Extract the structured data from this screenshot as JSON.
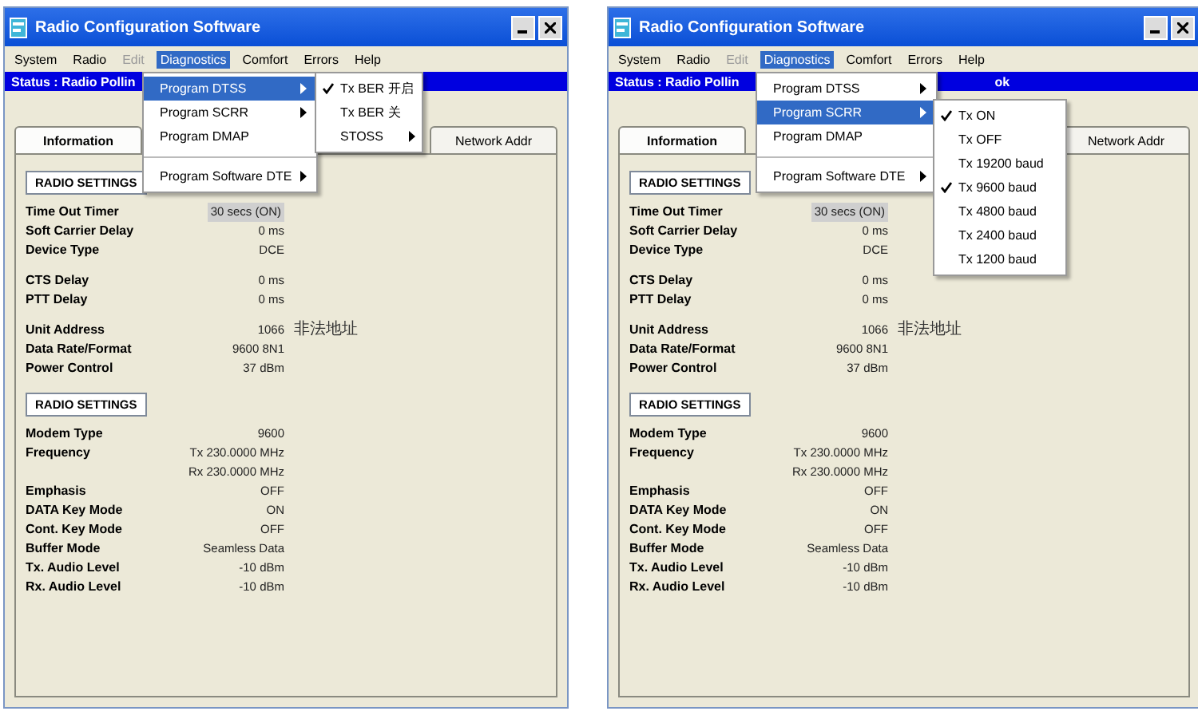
{
  "windows": [
    {
      "title": "Radio Configuration Software",
      "menus": [
        {
          "label": "System",
          "disabled": false,
          "open": false
        },
        {
          "label": "Radio",
          "disabled": false,
          "open": false
        },
        {
          "label": "Edit",
          "disabled": true,
          "open": false
        },
        {
          "label": "Diagnostics",
          "disabled": false,
          "open": true
        },
        {
          "label": "Comfort",
          "disabled": false,
          "open": false
        },
        {
          "label": "Errors",
          "disabled": false,
          "open": false
        },
        {
          "label": "Help",
          "disabled": false,
          "open": false
        }
      ],
      "status": "Status : Radio Pollin",
      "tabs": [
        {
          "label": "Information",
          "selected": true
        },
        {
          "label": "Network Addr",
          "selected": false
        }
      ],
      "sections": [
        {
          "heading": "RADIO SETTINGS",
          "groups": [
            {
              "rows": [
                {
                  "label": "Time Out Timer",
                  "values": [
                    "30 secs (ON)"
                  ],
                  "highlighted": true
                },
                {
                  "label": "Soft Carrier Delay",
                  "values": [
                    "0 ms"
                  ],
                  "highlighted": false
                },
                {
                  "label": "Device Type",
                  "values": [
                    "DCE"
                  ],
                  "highlighted": false
                }
              ]
            },
            {
              "rows": [
                {
                  "label": "CTS Delay",
                  "values": [
                    "0 ms"
                  ],
                  "highlighted": false
                },
                {
                  "label": "PTT Delay",
                  "values": [
                    "0 ms"
                  ],
                  "highlighted": false
                }
              ]
            },
            {
              "rows": [
                {
                  "label": "Unit Address",
                  "values": [
                    "1066"
                  ],
                  "note": "非法地址",
                  "highlighted": false
                },
                {
                  "label": "Data Rate/Format",
                  "values": [
                    "9600 8N1"
                  ],
                  "highlighted": false
                },
                {
                  "label": "Power Control",
                  "values": [
                    "37 dBm"
                  ],
                  "highlighted": false
                }
              ]
            }
          ]
        },
        {
          "heading": "RADIO SETTINGS",
          "groups": [
            {
              "rows": [
                {
                  "label": "Modem Type",
                  "values": [
                    "9600"
                  ],
                  "highlighted": false
                },
                {
                  "label": "Frequency",
                  "values": [
                    "Tx 230.0000 MHz",
                    "Rx 230.0000 MHz"
                  ],
                  "highlighted": false
                },
                {
                  "label": "Emphasis",
                  "values": [
                    "OFF"
                  ],
                  "highlighted": false
                },
                {
                  "label": "DATA Key Mode",
                  "values": [
                    "ON"
                  ],
                  "highlighted": false
                },
                {
                  "label": "Cont. Key Mode",
                  "values": [
                    "OFF"
                  ],
                  "highlighted": false
                },
                {
                  "label": "Buffer Mode",
                  "values": [
                    "Seamless Data"
                  ],
                  "highlighted": false
                },
                {
                  "label": "Tx. Audio Level",
                  "values": [
                    "-10 dBm"
                  ],
                  "highlighted": false
                },
                {
                  "label": "Rx. Audio Level",
                  "values": [
                    "-10 dBm"
                  ],
                  "highlighted": false
                }
              ]
            }
          ]
        }
      ],
      "dropdown": {
        "items": [
          {
            "label": "Program DTSS",
            "submenu": true,
            "selected": true,
            "separator_before": false
          },
          {
            "label": "Program SCRR",
            "submenu": true,
            "selected": false,
            "separator_before": false
          },
          {
            "label": "Program DMAP",
            "submenu": false,
            "selected": false,
            "separator_before": false
          },
          {
            "label": "Program Software DTE",
            "submenu": true,
            "selected": false,
            "separator_before": true
          }
        ],
        "submenu": {
          "items": [
            {
              "label": "Tx BER 开启",
              "checked": true,
              "submenu": false
            },
            {
              "label": "Tx BER 关",
              "checked": false,
              "submenu": false
            },
            {
              "label": "STOSS",
              "checked": false,
              "submenu": true
            }
          ]
        }
      }
    },
    {
      "title": "Radio Configuration Software",
      "menus": [
        {
          "label": "System",
          "disabled": false,
          "open": false
        },
        {
          "label": "Radio",
          "disabled": false,
          "open": false
        },
        {
          "label": "Edit",
          "disabled": true,
          "open": false
        },
        {
          "label": "Diagnostics",
          "disabled": false,
          "open": true
        },
        {
          "label": "Comfort",
          "disabled": false,
          "open": false
        },
        {
          "label": "Errors",
          "disabled": false,
          "open": false
        },
        {
          "label": "Help",
          "disabled": false,
          "open": false
        }
      ],
      "status": "Status : Radio Pollin",
      "status_tail": "ok",
      "tabs": [
        {
          "label": "Information",
          "selected": true
        },
        {
          "label": "Network Addr",
          "selected": false
        }
      ],
      "sections": [
        {
          "heading": "RADIO SETTINGS",
          "groups": [
            {
              "rows": [
                {
                  "label": "Time Out Timer",
                  "values": [
                    "30 secs (ON)"
                  ],
                  "highlighted": true
                },
                {
                  "label": "Soft Carrier Delay",
                  "values": [
                    "0 ms"
                  ],
                  "highlighted": false
                },
                {
                  "label": "Device Type",
                  "values": [
                    "DCE"
                  ],
                  "highlighted": false
                }
              ]
            },
            {
              "rows": [
                {
                  "label": "CTS Delay",
                  "values": [
                    "0 ms"
                  ],
                  "highlighted": false
                },
                {
                  "label": "PTT Delay",
                  "values": [
                    "0 ms"
                  ],
                  "highlighted": false
                }
              ]
            },
            {
              "rows": [
                {
                  "label": "Unit Address",
                  "values": [
                    "1066"
                  ],
                  "note": "非法地址",
                  "highlighted": false
                },
                {
                  "label": "Data Rate/Format",
                  "values": [
                    "9600 8N1"
                  ],
                  "highlighted": false
                },
                {
                  "label": "Power Control",
                  "values": [
                    "37 dBm"
                  ],
                  "highlighted": false
                }
              ]
            }
          ]
        },
        {
          "heading": "RADIO SETTINGS",
          "groups": [
            {
              "rows": [
                {
                  "label": "Modem Type",
                  "values": [
                    "9600"
                  ],
                  "highlighted": false
                },
                {
                  "label": "Frequency",
                  "values": [
                    "Tx 230.0000 MHz",
                    "Rx 230.0000 MHz"
                  ],
                  "highlighted": false
                },
                {
                  "label": "Emphasis",
                  "values": [
                    "OFF"
                  ],
                  "highlighted": false
                },
                {
                  "label": "DATA Key Mode",
                  "values": [
                    "ON"
                  ],
                  "highlighted": false
                },
                {
                  "label": "Cont. Key Mode",
                  "values": [
                    "OFF"
                  ],
                  "highlighted": false
                },
                {
                  "label": "Buffer Mode",
                  "values": [
                    "Seamless Data"
                  ],
                  "highlighted": false
                },
                {
                  "label": "Tx. Audio Level",
                  "values": [
                    "-10 dBm"
                  ],
                  "highlighted": false
                },
                {
                  "label": "Rx. Audio Level",
                  "values": [
                    "-10 dBm"
                  ],
                  "highlighted": false
                }
              ]
            }
          ]
        }
      ],
      "dropdown": {
        "items": [
          {
            "label": "Program DTSS",
            "submenu": true,
            "selected": false,
            "separator_before": false
          },
          {
            "label": "Program SCRR",
            "submenu": true,
            "selected": true,
            "separator_before": false
          },
          {
            "label": "Program DMAP",
            "submenu": false,
            "selected": false,
            "separator_before": false
          },
          {
            "label": "Program Software DTE",
            "submenu": true,
            "selected": false,
            "separator_before": true
          }
        ],
        "submenu": {
          "items": [
            {
              "label": "Tx ON",
              "checked": true,
              "submenu": false
            },
            {
              "label": "Tx OFF",
              "checked": false,
              "submenu": false
            },
            {
              "label": "Tx 19200 baud",
              "checked": false,
              "submenu": false
            },
            {
              "label": "Tx 9600 baud",
              "checked": true,
              "submenu": false
            },
            {
              "label": "Tx 4800 baud",
              "checked": false,
              "submenu": false
            },
            {
              "label": "Tx 2400 baud",
              "checked": false,
              "submenu": false
            },
            {
              "label": "Tx 1200 baud",
              "checked": false,
              "submenu": false
            }
          ]
        }
      }
    }
  ]
}
